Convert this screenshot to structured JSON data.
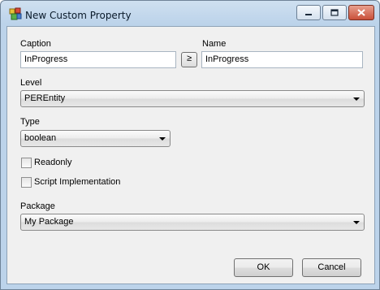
{
  "window": {
    "title": "New Custom Property",
    "controls": {
      "minimize": "minimize-icon",
      "maximize": "maximize-icon",
      "close": "close-icon"
    }
  },
  "form": {
    "caption": {
      "label": "Caption",
      "value": "InProgress"
    },
    "copy_button": {
      "label": "≥"
    },
    "name": {
      "label": "Name",
      "value": "InProgress"
    },
    "level": {
      "label": "Level",
      "value": "PEREntity"
    },
    "type": {
      "label": "Type",
      "value": "boolean"
    },
    "readonly": {
      "label": "Readonly",
      "checked": false
    },
    "script_impl": {
      "label": "Script Implementation",
      "checked": false
    },
    "package": {
      "label": "Package",
      "value": "My Package"
    }
  },
  "buttons": {
    "ok": "OK",
    "cancel": "Cancel"
  }
}
